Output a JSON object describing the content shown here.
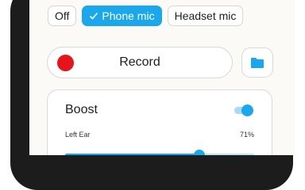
{
  "mic_modes": [
    {
      "label": "Off",
      "selected": false
    },
    {
      "label": "Phone mic",
      "selected": true
    },
    {
      "label": "Headset mic",
      "selected": false
    }
  ],
  "record": {
    "label": "Record",
    "dot_color": "#e8141c"
  },
  "folder_icon": "folder-icon",
  "boost": {
    "title": "Boost",
    "enabled": true,
    "left_ear": {
      "label": "Left Ear",
      "value_text": "71%",
      "level": 0.71
    }
  },
  "colors": {
    "accent": "#1aa7ec",
    "record": "#e8141c"
  }
}
